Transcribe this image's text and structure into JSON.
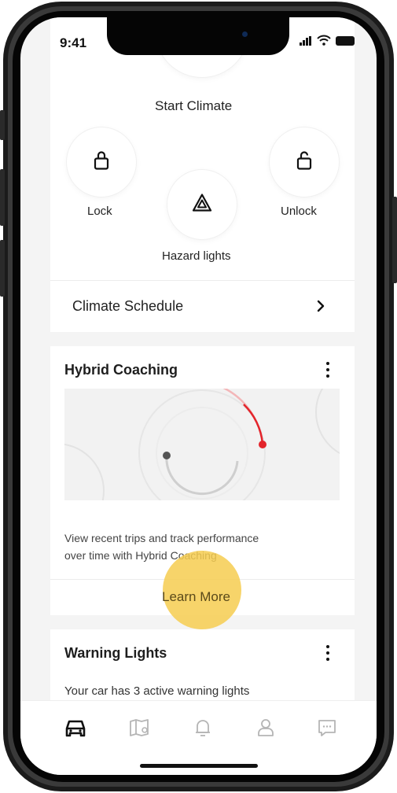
{
  "status_bar": {
    "time": "9:41"
  },
  "remote": {
    "start_climate_label": "Start Climate",
    "lock_label": "Lock",
    "unlock_label": "Unlock",
    "hazard_label": "Hazard lights",
    "schedule_label": "Climate Schedule"
  },
  "hybrid_coaching": {
    "title": "Hybrid Coaching",
    "description_line1": "View recent trips and track performance",
    "description_line2": "over time with Hybrid Coaching",
    "cta": "Learn More"
  },
  "warning_lights": {
    "title": "Warning Lights",
    "description": "Your car has 3 active warning lights"
  },
  "tab_bar": {
    "items": [
      "car",
      "map",
      "notifications",
      "profile",
      "messages"
    ],
    "active": "car"
  },
  "colors": {
    "accent_red": "#e3242b",
    "highlight": "#f6cd50",
    "icon_inactive": "#b5b5b5"
  },
  "icons": [
    "lock-icon",
    "unlock-icon",
    "hazard-icon",
    "chevron-right-icon",
    "more-vertical-icon",
    "car-icon",
    "map-icon",
    "bell-icon",
    "user-icon",
    "chat-icon"
  ]
}
